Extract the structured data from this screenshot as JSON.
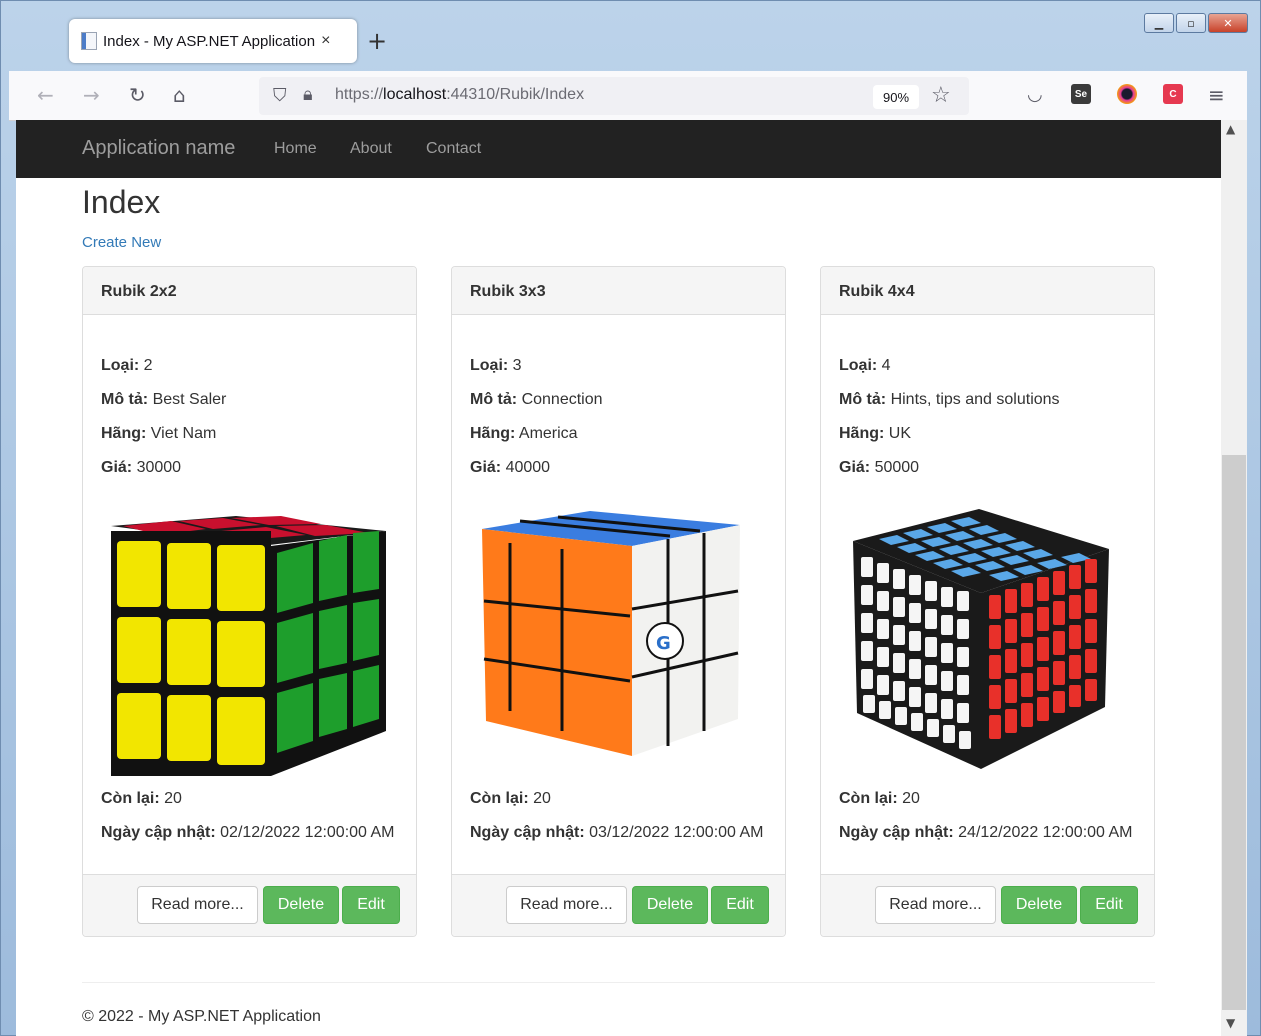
{
  "browser": {
    "tab_title": "Index - My ASP.NET Application",
    "tab_close": "×",
    "new_tab": "+",
    "url_prefix": "https://",
    "url_host": "localhost",
    "url_rest": ":44310/Rubik/Index",
    "zoom": "90%",
    "icons": [
      "back-icon",
      "forward-icon",
      "reload-icon",
      "home-icon",
      "shield-icon",
      "lock-icon",
      "star-icon",
      "pocket-icon",
      "menu-icon"
    ]
  },
  "app": {
    "brand": "Application name",
    "nav": [
      "Home",
      "About",
      "Contact"
    ],
    "title": "Index",
    "create_link": "Create New",
    "footer": "© 2022 - My ASP.NET Application"
  },
  "labels": {
    "type": "Loại:",
    "desc": "Mô tả:",
    "brand": "Hãng:",
    "price": "Giá:",
    "stock": "Còn lại:",
    "updated": "Ngày cập nhật:",
    "read_more": "Read more...",
    "delete": "Delete",
    "edit": "Edit"
  },
  "products": [
    {
      "name": "Rubik 2x2",
      "type": "2",
      "desc": "Best Saler",
      "brand": "Viet Nam",
      "price": "30000",
      "stock": "20",
      "updated": "02/12/2022 12:00:00 AM"
    },
    {
      "name": "Rubik 3x3",
      "type": "3",
      "desc": "Connection",
      "brand": "America",
      "price": "40000",
      "stock": "20",
      "updated": "03/12/2022 12:00:00 AM"
    },
    {
      "name": "Rubik 4x4",
      "type": "4",
      "desc": "Hints, tips and solutions",
      "brand": "UK",
      "price": "50000",
      "stock": "20",
      "updated": "24/12/2022 12:00:00 AM"
    }
  ],
  "colors": {
    "navbar": "#222222",
    "link": "#337ab7",
    "success": "#5cb85c"
  }
}
